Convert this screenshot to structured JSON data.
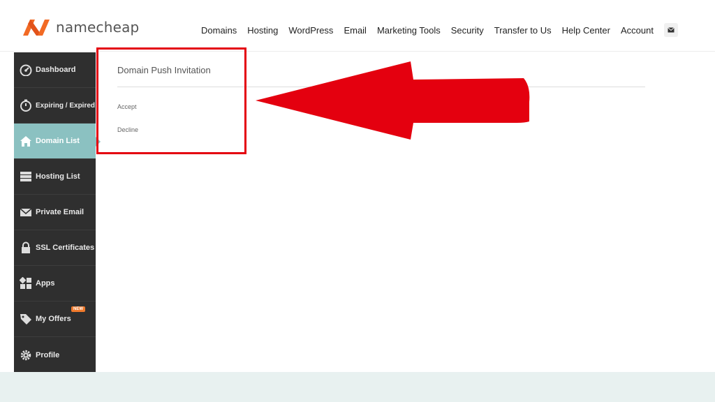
{
  "brand": {
    "name": "namecheap"
  },
  "topnav": {
    "items": [
      "Domains",
      "Hosting",
      "WordPress",
      "Email",
      "Marketing Tools",
      "Security",
      "Transfer to Us",
      "Help Center",
      "Account"
    ]
  },
  "sidebar": {
    "items": [
      {
        "label": "Dashboard",
        "icon": "dashboard-icon"
      },
      {
        "label": "Expiring / Expired",
        "icon": "stopwatch-icon"
      },
      {
        "label": "Domain List",
        "icon": "home-icon",
        "active": true
      },
      {
        "label": "Hosting List",
        "icon": "server-icon"
      },
      {
        "label": "Private Email",
        "icon": "envelope-icon"
      },
      {
        "label": "SSL Certificates",
        "icon": "lock-icon"
      },
      {
        "label": "Apps",
        "icon": "apps-icon"
      },
      {
        "label": "My Offers",
        "icon": "tag-icon",
        "badge": "NEW"
      },
      {
        "label": "Profile",
        "icon": "gear-icon"
      }
    ]
  },
  "panel": {
    "title": "Domain Push Invitation",
    "accept_label": "Accept",
    "decline_label": "Decline"
  },
  "colors": {
    "brand_orange": "#f26a24",
    "sidebar_bg": "#2f2f2f",
    "sidebar_active": "#8bc1c1",
    "annotation_red": "#e4000f",
    "footer_band": "#e8f1f0"
  }
}
